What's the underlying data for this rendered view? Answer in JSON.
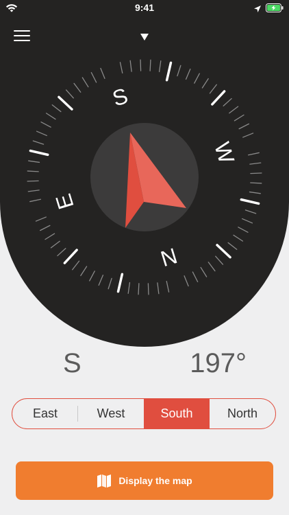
{
  "status_bar": {
    "time": "9:41"
  },
  "compass": {
    "bezel_rotation_deg": -197,
    "cardinal_labels": {
      "north": "N",
      "east": "E",
      "south": "S",
      "west": "W"
    }
  },
  "reading": {
    "direction": "S",
    "degrees": "197°"
  },
  "segments": [
    {
      "label": "East",
      "active": false
    },
    {
      "label": "West",
      "active": false
    },
    {
      "label": "South",
      "active": true
    },
    {
      "label": "North",
      "active": false
    }
  ],
  "map_button": {
    "label": "Display the map",
    "icon": "map-icon"
  },
  "colors": {
    "accent": "#e04e3f",
    "map_button": "#f07d2f",
    "dial_background": "#242322",
    "needle": "#e04e3f"
  }
}
